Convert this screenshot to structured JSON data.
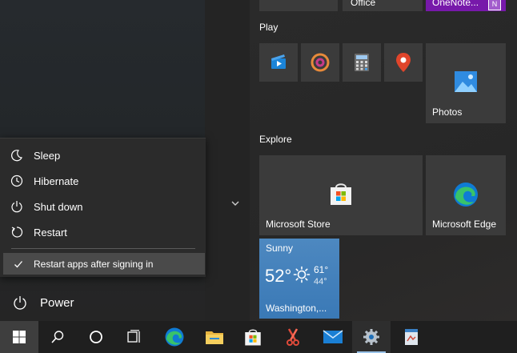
{
  "top_tiles": {
    "office_label": "Office",
    "onenote_label": "OneNote..."
  },
  "sections": {
    "play": "Play",
    "explore": "Explore"
  },
  "tiles": {
    "photos": "Photos",
    "store": "Microsoft Store",
    "edge": "Microsoft Edge"
  },
  "weather": {
    "condition": "Sunny",
    "temp": "52°",
    "high": "61°",
    "low": "44°",
    "city": "Washington,..."
  },
  "power_menu": {
    "items": [
      "Sleep",
      "Hibernate",
      "Shut down",
      "Restart"
    ],
    "check_option": "Restart apps after signing in"
  },
  "power_label": "Power",
  "colors": {
    "accent": "#0078d7",
    "onenote": "#7719aa",
    "weather": "#3a79b6"
  }
}
